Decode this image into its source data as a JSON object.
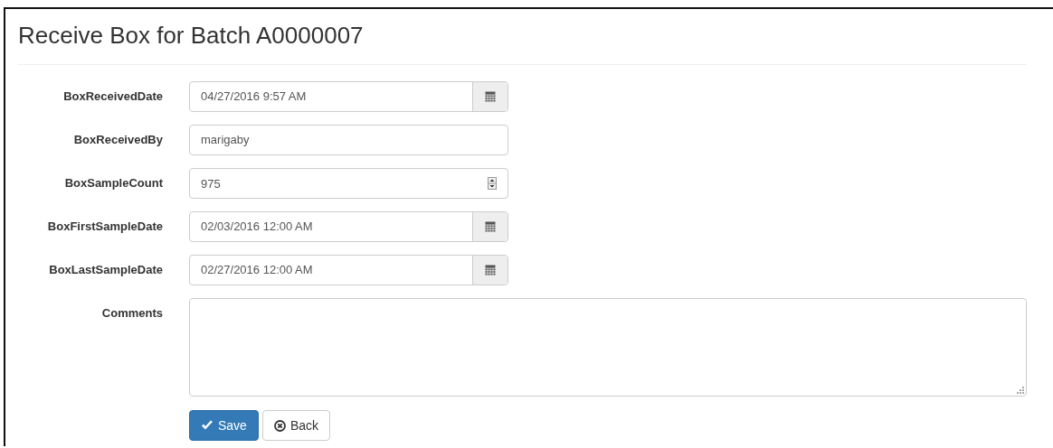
{
  "title": "Receive Box for Batch A0000007",
  "fields": [
    {
      "label": "BoxReceivedDate",
      "kind": "date",
      "value": "04/27/2016 9:57 AM"
    },
    {
      "label": "BoxReceivedBy",
      "kind": "text",
      "value": "marigaby"
    },
    {
      "label": "BoxSampleCount",
      "kind": "number",
      "value": "975"
    },
    {
      "label": "BoxFirstSampleDate",
      "kind": "date",
      "value": "02/03/2016 12:00 AM"
    },
    {
      "label": "BoxLastSampleDate",
      "kind": "date",
      "value": "02/27/2016 12:00 AM"
    },
    {
      "label": "Comments",
      "kind": "textarea"
    }
  ],
  "buttons": [
    {
      "label": "Save",
      "kind": "primary"
    },
    {
      "label": "Back",
      "kind": "back"
    }
  ]
}
